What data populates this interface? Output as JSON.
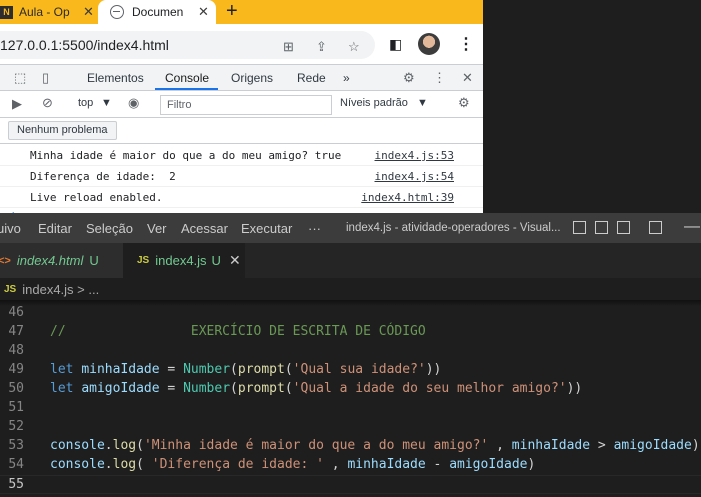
{
  "browser": {
    "tabs": [
      {
        "title": "Aula - Op",
        "favicon": "N"
      },
      {
        "title": "Documen",
        "favicon": "globe-icon"
      }
    ],
    "new_tab": "+",
    "url": "127.0.0.1:5500/index4.html",
    "accent_color": "#f9b81c"
  },
  "devtools": {
    "tabs": [
      "Elementos",
      "Console",
      "Origens",
      "Rede"
    ],
    "more_tabs": "»",
    "context": "top",
    "filter_placeholder": "Filtro",
    "levels": "Níveis padrão",
    "issues_button": "Nenhum problema",
    "console": [
      {
        "message": "Minha idade é maior do que a do meu amigo? true",
        "source": "index4.js:53"
      },
      {
        "message": "Diferença de idade:  2",
        "source": "index4.js:54"
      },
      {
        "message": "Live reload enabled.",
        "source": "index4.html:39"
      }
    ],
    "prompt": "›"
  },
  "vscode": {
    "menu": [
      "uivo",
      "Editar",
      "Seleção",
      "Ver",
      "Acessar",
      "Executar",
      "···"
    ],
    "window_title": "index4.js - atividade-operadores - Visual...",
    "tabs": [
      {
        "icon": "<>",
        "name": "index4.html",
        "status": "U"
      },
      {
        "icon": "JS",
        "name": "index4.js",
        "status": "U",
        "close": "✕"
      }
    ],
    "breadcrumb": {
      "icon": "JS",
      "path": "index4.js > ..."
    },
    "line_numbers": [
      "46",
      "47",
      "48",
      "49",
      "50",
      "51",
      "52",
      "53",
      "54",
      "55"
    ],
    "code": {
      "l47_comment": "//                EXERCÍCIO DE ESCRITA DE CÓDIGO",
      "l49_let": "let",
      "l49_var": "minhaIdade",
      "l49_eq": " = ",
      "l49_num": "Number",
      "l49_open": "(",
      "l49_prompt": "prompt",
      "l49_str": "'Qual sua idade?'",
      "l49_close": "))",
      "l50_let": "let",
      "l50_var": "amigoIdade",
      "l50_eq": " = ",
      "l50_num": "Number",
      "l50_open": "(",
      "l50_prompt": "prompt",
      "l50_str": "'Qual a idade do seu melhor amigo?'",
      "l50_close": "))",
      "l53_console": "console",
      "l53_dot": ".",
      "l53_log": "log",
      "l53_open": "(",
      "l53_str": "'Minha idade é maior do que a do meu amigo?'",
      "l53_comma": " , ",
      "l53_a": "minhaIdade",
      "l53_op": " > ",
      "l53_b": "amigoIdade",
      "l53_close": ")",
      "l54_console": "console",
      "l54_dot": ".",
      "l54_log": "log",
      "l54_open": "( ",
      "l54_str": "'Diferença de idade: '",
      "l54_comma": " , ",
      "l54_a": "minhaIdade",
      "l54_op": " - ",
      "l54_b": "amigoIdade",
      "l54_close": ")"
    }
  }
}
